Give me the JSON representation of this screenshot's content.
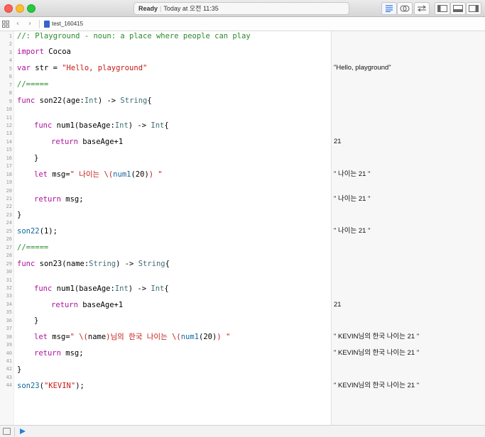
{
  "status": {
    "state": "Ready",
    "time": "Today at 오전 11:35"
  },
  "file": {
    "name": "test_160415"
  },
  "icons": {
    "grid": "grid-icon",
    "back": "chevron-left-icon",
    "forward": "chevron-right-icon",
    "file": "swift-file-icon",
    "play": "play-icon",
    "console": "console-icon"
  },
  "code": {
    "line1": "//: Playground - noun: a place where people can play",
    "line3": {
      "kw": "import",
      "rest": " Cocoa"
    },
    "line5": {
      "kw": "var",
      "mid": " str = ",
      "str": "\"Hello, playground\""
    },
    "line7": "//=====",
    "line9": {
      "kw": "func",
      "a": " son22(age:",
      "t1": "Int",
      "b": ") -> ",
      "t2": "String",
      "c": "{"
    },
    "line12": {
      "kw": "func",
      "a": " num1(baseAge:",
      "t1": "Int",
      "b": ") -> ",
      "t2": "Int",
      "c": "{"
    },
    "line14": {
      "kw": "return",
      "rest": " baseAge+1"
    },
    "line16": "}",
    "line18": {
      "kw": "let",
      "a": " msg=",
      "s1": "\" 나이는 \\(",
      "fn": "num1",
      "p1": "(",
      "n": "20",
      "p2": ")",
      "s2": ") \""
    },
    "line21": {
      "kw": "return",
      "rest": " msg;"
    },
    "line23": "}",
    "line25": {
      "fn": "son22",
      "p1": "(",
      "n": "1",
      "p2": ");"
    },
    "line27": "//=====",
    "line29": {
      "kw": "func",
      "a": " son23(name:",
      "t1": "String",
      "b": ") -> ",
      "t2": "String",
      "c": "{"
    },
    "line32": {
      "kw": "func",
      "a": " num1(baseAge:",
      "t1": "Int",
      "b": ") -> ",
      "t2": "Int",
      "c": "{"
    },
    "line34": {
      "kw": "return",
      "rest": " baseAge+1"
    },
    "line36": "}",
    "line38": {
      "kw": "let",
      "a": " msg=",
      "s1": "\" \\(",
      "v": "name",
      "s2": ")님의 한국 나이는 \\(",
      "fn": "num1",
      "p1": "(",
      "n": "20",
      "p2": ")",
      "s3": ") \""
    },
    "line40": {
      "kw": "return",
      "rest": " msg;"
    },
    "line42": "}",
    "line44": {
      "fn": "son23",
      "p1": "(",
      "str": "\"KEVIN\"",
      "p2": ");"
    }
  },
  "results": {
    "r5": "\"Hello, playground\"",
    "r14": "21",
    "r18": "\" 나이는 21 \"",
    "r21": "\" 나이는 21 \"",
    "r25": "\" 나이는 21 \"",
    "r34": "21",
    "r38": "\" KEVIN님의 한국 나이는 21 \"",
    "r40": "\" KEVIN님의 한국 나이는 21 \"",
    "r44": "\" KEVIN님의 한국 나이는 21 \""
  },
  "line_numbers": [
    "1",
    "2",
    "3",
    "4",
    "5",
    "6",
    "7",
    "8",
    "9",
    "10",
    "11",
    "12",
    "13",
    "14",
    "15",
    "16",
    "17",
    "18",
    "19",
    "20",
    "21",
    "22",
    "23",
    "24",
    "25",
    "26",
    "27",
    "28",
    "29",
    "30",
    "31",
    "32",
    "33",
    "34",
    "35",
    "36",
    "37",
    "38",
    "39",
    "40",
    "41",
    "42",
    "43",
    "44"
  ]
}
